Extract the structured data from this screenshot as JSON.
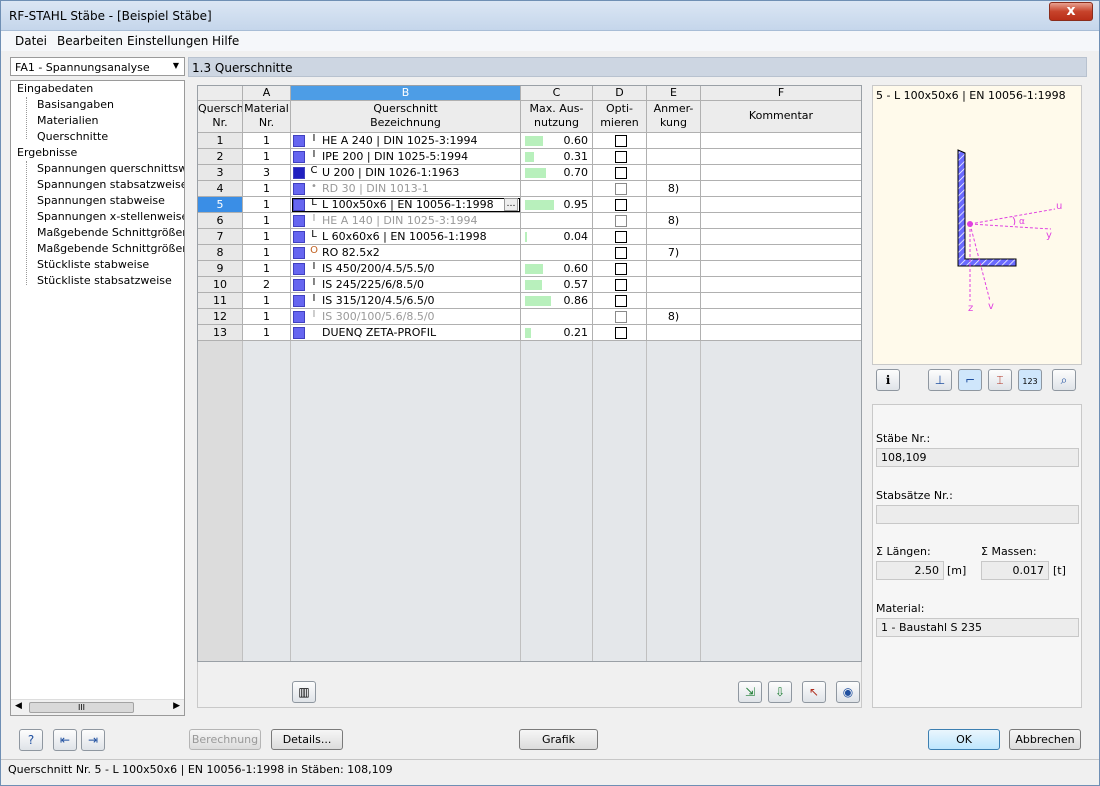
{
  "window": {
    "title": "RF-STAHL Stäbe - [Beispiel Stäbe]",
    "close_glyph": "x"
  },
  "menu": [
    "Datei",
    "Bearbeiten",
    "Einstellungen",
    "Hilfe"
  ],
  "case_dropdown": {
    "value": "FA1 - Spannungsanalyse"
  },
  "tree": {
    "input_header": "Eingabedaten",
    "input_items": [
      "Basisangaben",
      "Materialien",
      "Querschnitte"
    ],
    "results_header": "Ergebnisse",
    "results_items": [
      "Spannungen querschnittsweise",
      "Spannungen stabsatzweise",
      "Spannungen stabweise",
      "Spannungen x-stellenweise",
      "Maßgebende Schnittgrößen sta",
      "Maßgebende Schnittgrößen sta",
      "Stückliste stabweise",
      "Stückliste stabsatzweise"
    ],
    "scroll_thumb": "III"
  },
  "section_title": "1.3 Querschnitte",
  "table": {
    "col_letters": [
      "A",
      "B",
      "C",
      "D",
      "E",
      "F"
    ],
    "hdr_nr": [
      "Quersch.",
      "Nr."
    ],
    "hdr_mat": [
      "Material",
      "Nr."
    ],
    "hdr_qs": [
      "Querschnitt",
      "Bezeichnung"
    ],
    "hdr_aus": [
      "Max. Aus-",
      "nutzung"
    ],
    "hdr_opt": [
      "Opti-",
      "mieren"
    ],
    "hdr_anm": [
      "Anmer-",
      "kung"
    ],
    "hdr_kom": "Kommentar",
    "rows": [
      {
        "nr": "1",
        "mat": "1",
        "icon": "I",
        "name": "HE A 240 | DIN 1025-3:1994",
        "ratio": "0.60",
        "util": 0.6,
        "note": "",
        "grey": false,
        "swatch": "#6666f0"
      },
      {
        "nr": "2",
        "mat": "1",
        "icon": "I",
        "name": "IPE 200 | DIN 1025-5:1994",
        "ratio": "0.31",
        "util": 0.31,
        "note": "",
        "grey": false,
        "swatch": "#6666f0"
      },
      {
        "nr": "3",
        "mat": "3",
        "icon": "C",
        "name": "U 200 | DIN 1026-1:1963",
        "ratio": "0.70",
        "util": 0.7,
        "note": "",
        "grey": false,
        "swatch": "#2020c0"
      },
      {
        "nr": "4",
        "mat": "1",
        "icon": "•",
        "name": "RD 30 | DIN 1013-1",
        "ratio": "",
        "util": 0,
        "note": "8)",
        "grey": true,
        "swatch": "#6666f0"
      },
      {
        "nr": "5",
        "mat": "1",
        "icon": "L",
        "name": "L 100x50x6 | EN 10056-1:1998",
        "ratio": "0.95",
        "util": 0.95,
        "note": "",
        "grey": false,
        "swatch": "#6666f0",
        "selected": true
      },
      {
        "nr": "6",
        "mat": "1",
        "icon": "I",
        "name": "HE A 140 | DIN 1025-3:1994",
        "ratio": "",
        "util": 0,
        "note": "8)",
        "grey": true,
        "swatch": "#6666f0"
      },
      {
        "nr": "7",
        "mat": "1",
        "icon": "L",
        "name": "L 60x60x6 | EN 10056-1:1998",
        "ratio": "0.04",
        "util": 0.04,
        "note": "",
        "grey": false,
        "swatch": "#6666f0"
      },
      {
        "nr": "8",
        "mat": "1",
        "icon": "O",
        "name": "RO 82.5x2",
        "ratio": "",
        "util": 0,
        "note": "7)",
        "grey": false,
        "swatch": "#6666f0"
      },
      {
        "nr": "9",
        "mat": "1",
        "icon": "I",
        "name": "IS 450/200/4.5/5.5/0",
        "ratio": "0.60",
        "util": 0.6,
        "note": "",
        "grey": false,
        "swatch": "#6666f0"
      },
      {
        "nr": "10",
        "mat": "2",
        "icon": "I",
        "name": "IS 245/225/6/8.5/0",
        "ratio": "0.57",
        "util": 0.57,
        "note": "",
        "grey": false,
        "swatch": "#6666f0"
      },
      {
        "nr": "11",
        "mat": "1",
        "icon": "I",
        "name": "IS 315/120/4.5/6.5/0",
        "ratio": "0.86",
        "util": 0.86,
        "note": "",
        "grey": false,
        "swatch": "#6666f0"
      },
      {
        "nr": "12",
        "mat": "1",
        "icon": "I",
        "name": "IS 300/100/5.6/8.5/0",
        "ratio": "",
        "util": 0,
        "note": "8)",
        "grey": true,
        "swatch": "#6666f0"
      },
      {
        "nr": "13",
        "mat": "1",
        "icon": "",
        "name": "DUENQ ZETA-PROFIL",
        "ratio": "0.21",
        "util": 0.21,
        "note": "",
        "grey": false,
        "swatch": "#6666f0"
      }
    ]
  },
  "preview": {
    "title": "5 - L 100x50x6 | EN 10056-1:1998",
    "axis_u": "u",
    "axis_y": "y",
    "axis_z": "z",
    "axis_v": "v",
    "angle": "α"
  },
  "info": {
    "staebe_label": "Stäbe Nr.:",
    "staebe_value": "108,109",
    "stabsaetze_label": "Stabsätze Nr.:",
    "stabsaetze_value": "",
    "laengen_label": "Σ Längen:",
    "laengen_value": "2.50",
    "laengen_unit": "[m]",
    "massen_label": "Σ Massen:",
    "massen_value": "0.017",
    "massen_unit": "[t]",
    "material_label": "Material:",
    "material_value": "1 - Baustahl S 235"
  },
  "buttons": {
    "berechnung": "Berechnung",
    "details": "Details...",
    "grafik": "Grafik",
    "ok": "OK",
    "abbrechen": "Abbrechen"
  },
  "status": "Querschnitt Nr. 5 - L 100x50x6 | EN 10056-1:1998 in Stäben: 108,109"
}
